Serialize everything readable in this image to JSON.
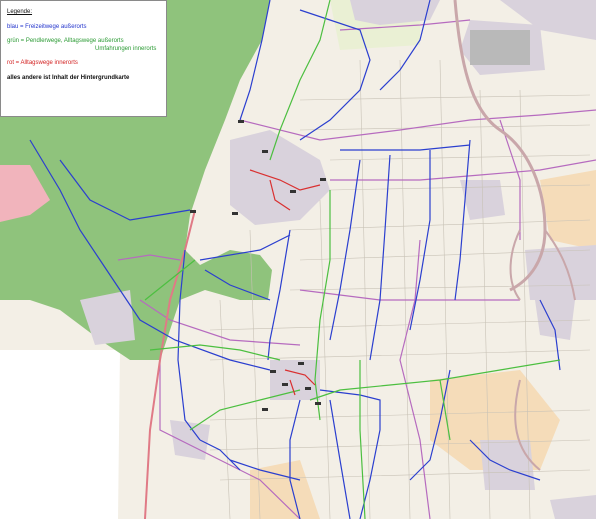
{
  "legend": {
    "title": "Legende:",
    "blue": "blau = Freizeitwege außerorts",
    "green_line1": "grün = Pendlerwege, Alltagswege außerorts",
    "green_line2": "Umfahrungen innerorts",
    "red": "rot  =  Alltagswege innerorts",
    "other": "alles andere ist Inhalt der Hintergrundkarte"
  },
  "colors": {
    "route_blue": "#2b3fcf",
    "route_green": "#4cbf40",
    "route_red": "#d93030",
    "forest": "#8fc37c",
    "farmland": "#f3efe6",
    "settlement": "#d9d2dc",
    "boundary": "#b66bbf"
  }
}
